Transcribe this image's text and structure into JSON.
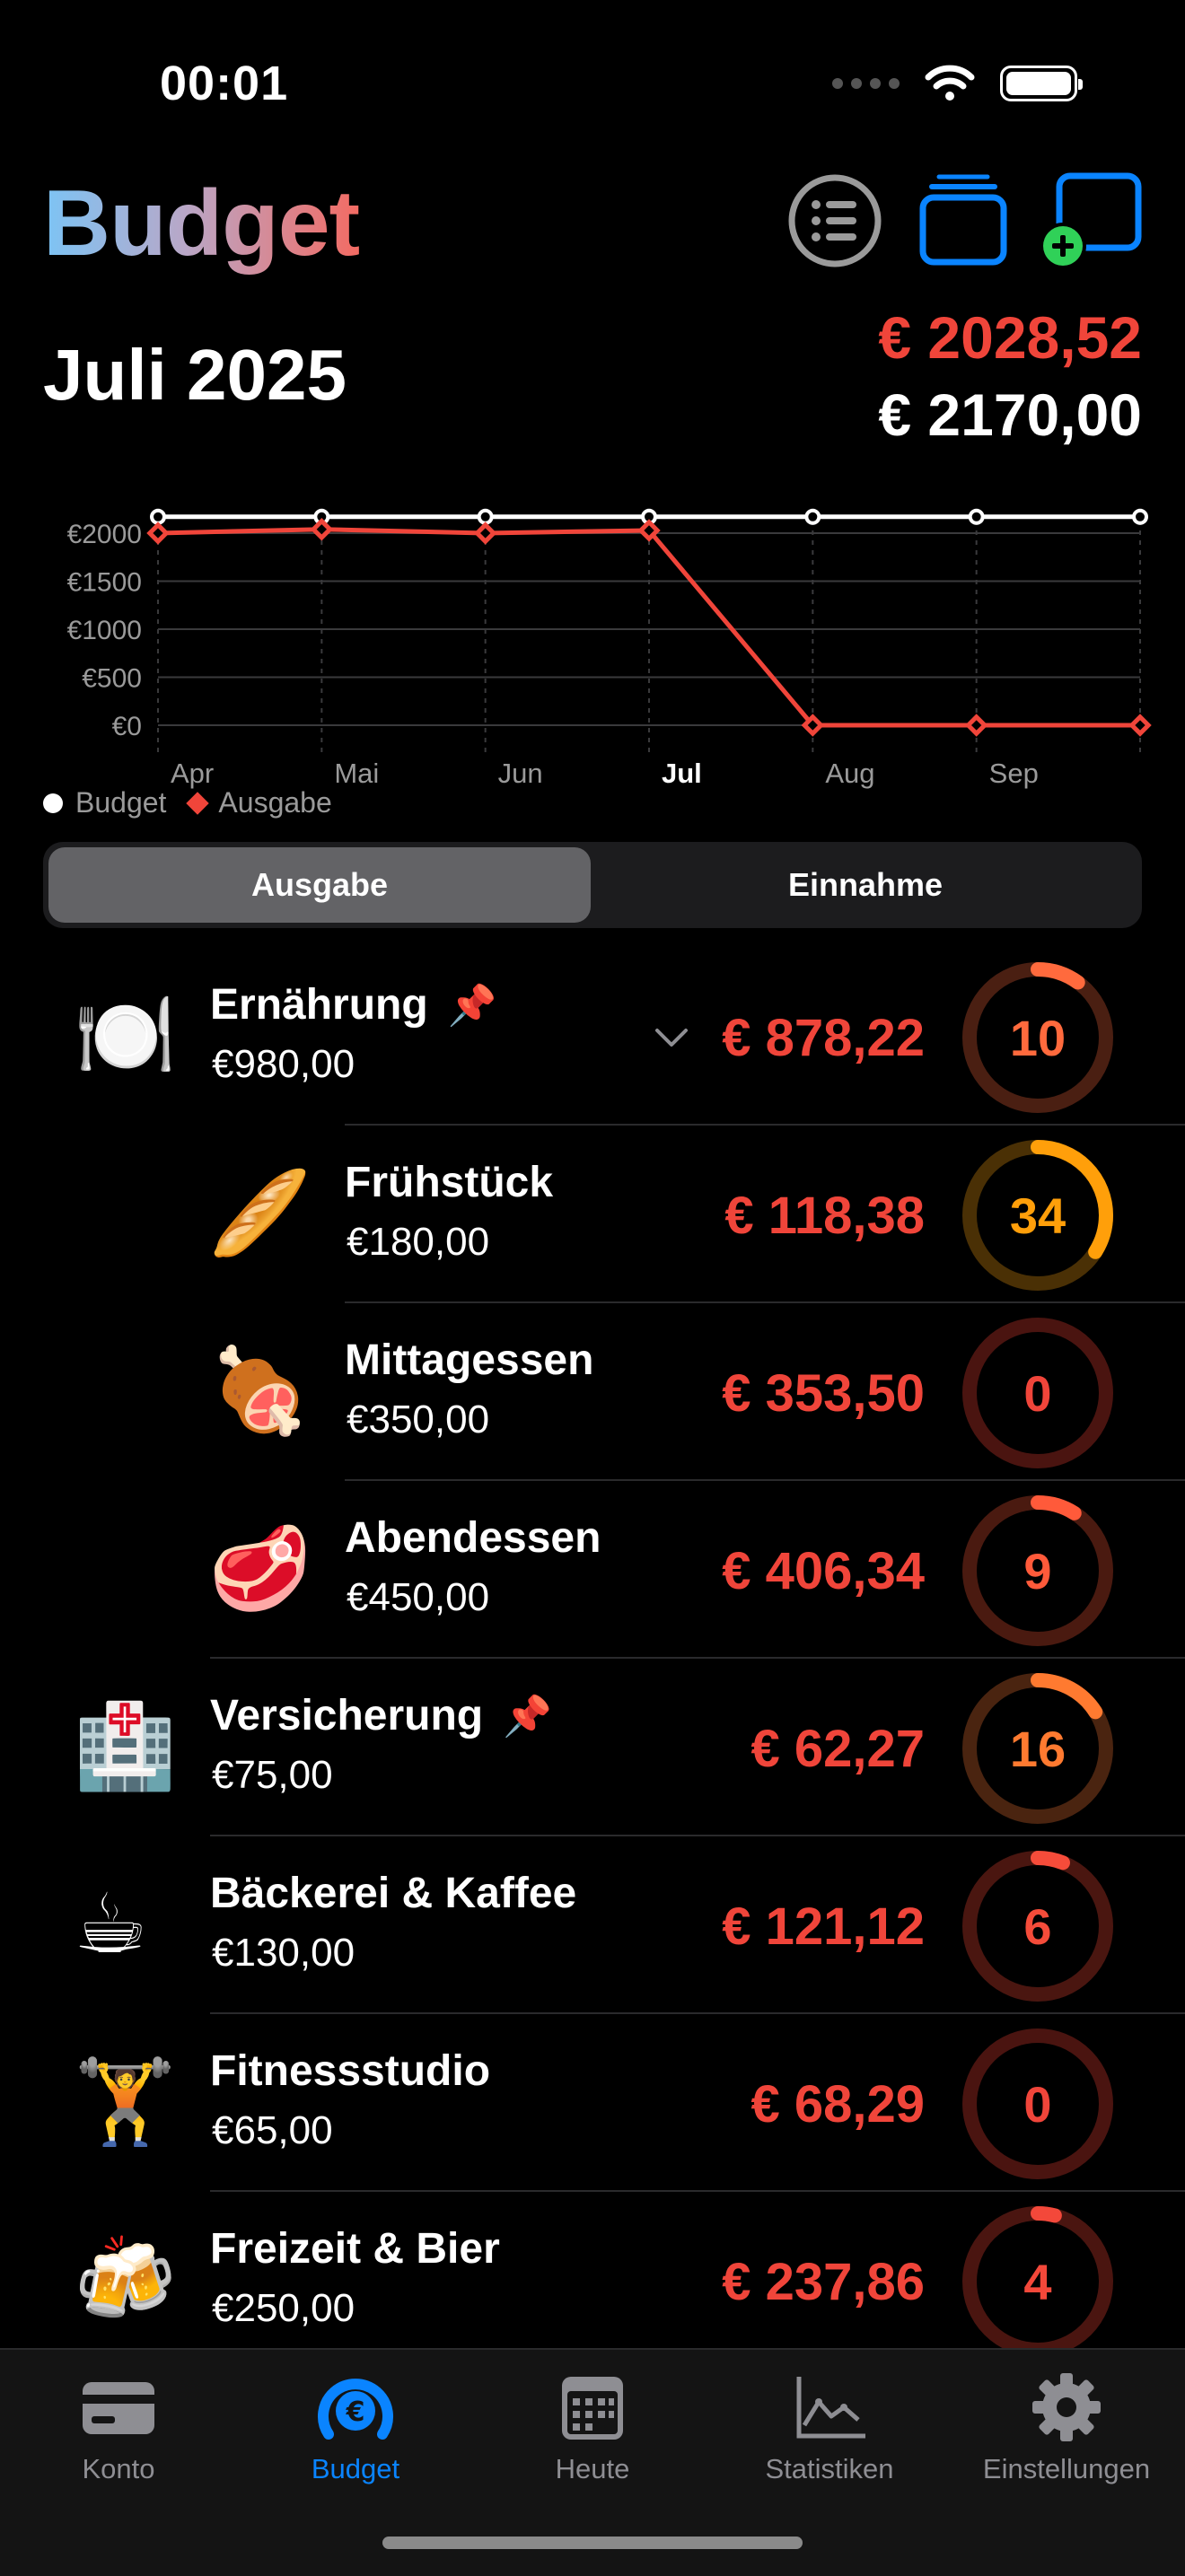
{
  "status_bar": {
    "time": "00:01"
  },
  "header": {
    "title": "Budget",
    "month": "Juli 2025",
    "total_spent": "€ 2028,52",
    "total_budget": "€ 2170,00"
  },
  "chart_data": {
    "type": "line",
    "x": [
      "Apr",
      "Mai",
      "Jun",
      "Jul",
      "Aug",
      "Sep"
    ],
    "highlighted_x": "Jul",
    "y_tick_labels": [
      "€2000",
      "€1500",
      "€1000",
      "€500",
      "€0"
    ],
    "y_ticks": [
      2000,
      1500,
      1000,
      500,
      0
    ],
    "ylim": [
      0,
      2200
    ],
    "points_x": [
      0,
      1,
      2,
      3,
      4,
      5,
      6
    ],
    "series": [
      {
        "name": "Budget",
        "color": "#ffffff",
        "marker": "circle",
        "values": [
          2170,
          2170,
          2170,
          2170,
          2170,
          2170,
          2170
        ]
      },
      {
        "name": "Ausgabe",
        "color": "#f0453a",
        "marker": "diamond",
        "values": [
          2000,
          2040,
          2000,
          2028.52,
          0,
          0,
          0
        ]
      }
    ],
    "grid": true,
    "legend": "bottom-left"
  },
  "legend": {
    "budget": "Budget",
    "expense": "Ausgabe"
  },
  "segmented": {
    "selected": "Ausgabe",
    "other": "Einnahme"
  },
  "categories": [
    {
      "emoji": "🍽️",
      "name": "Ernährung",
      "budget": "€980,00",
      "spent": "€ 878,22",
      "ring_value": "10",
      "progress": 0.1,
      "pinned": true,
      "expanded": true,
      "level": 0,
      "ring_color": "#ff6a3d",
      "track_color": "#4a1f12",
      "num_color": "#ff6a3d"
    },
    {
      "emoji": "🥖",
      "name": "Frühstück",
      "budget": "€180,00",
      "spent": "€ 118,38",
      "ring_value": "34",
      "progress": 0.34,
      "pinned": false,
      "level": 1,
      "ring_color": "#ff9f0a",
      "track_color": "#4a3005",
      "num_color": "#ff9f0a"
    },
    {
      "emoji": "🍖",
      "name": "Mittagessen",
      "budget": "€350,00",
      "spent": "€ 353,50",
      "ring_value": "0",
      "progress": 0,
      "pinned": false,
      "level": 1,
      "ring_color": "#f0453a",
      "track_color": "#4a1410",
      "num_color": "#f0453a"
    },
    {
      "emoji": "🥩",
      "name": "Abendessen",
      "budget": "€450,00",
      "spent": "€ 406,34",
      "ring_value": "9",
      "progress": 0.09,
      "pinned": false,
      "level": 1,
      "ring_color": "#ff5a3a",
      "track_color": "#4a1a10",
      "num_color": "#ff5a3a"
    },
    {
      "emoji": "🏥",
      "name": "Versicherung",
      "budget": "€75,00",
      "spent": "€ 62,27",
      "ring_value": "16",
      "progress": 0.16,
      "pinned": true,
      "level": 0,
      "ring_color": "#ff7a30",
      "track_color": "#4a2410",
      "num_color": "#ff7a30"
    },
    {
      "emoji": "☕",
      "name": "Bäckerei & Kaffee",
      "budget": "€130,00",
      "spent": "€ 121,12",
      "ring_value": "6",
      "progress": 0.06,
      "pinned": false,
      "level": 0,
      "ring_color": "#f54c3a",
      "track_color": "#4a1610",
      "num_color": "#f54c3a"
    },
    {
      "emoji": "🏋️",
      "name": "Fitnessstudio",
      "budget": "€65,00",
      "spent": "€ 68,29",
      "ring_value": "0",
      "progress": 0,
      "pinned": false,
      "level": 0,
      "ring_color": "#f0453a",
      "track_color": "#4a1410",
      "num_color": "#f0453a"
    },
    {
      "emoji": "🍻",
      "name": "Freizeit & Bier",
      "budget": "€250,00",
      "spent": "€ 237,86",
      "ring_value": "4",
      "progress": 0.04,
      "pinned": false,
      "level": 0,
      "ring_color": "#f3483a",
      "track_color": "#4a1510",
      "num_color": "#f3483a"
    }
  ],
  "tabs": [
    {
      "label": "Konto",
      "icon": "card-icon",
      "active": false
    },
    {
      "label": "Budget",
      "icon": "euro-gauge-icon",
      "active": true
    },
    {
      "label": "Heute",
      "icon": "calendar-icon",
      "active": false
    },
    {
      "label": "Statistiken",
      "icon": "chart-icon",
      "active": false
    },
    {
      "label": "Einstellungen",
      "icon": "gear-icon",
      "active": false
    }
  ],
  "colors": {
    "accent": "#0a84ff",
    "expense": "#f0453a",
    "background": "#000000"
  }
}
